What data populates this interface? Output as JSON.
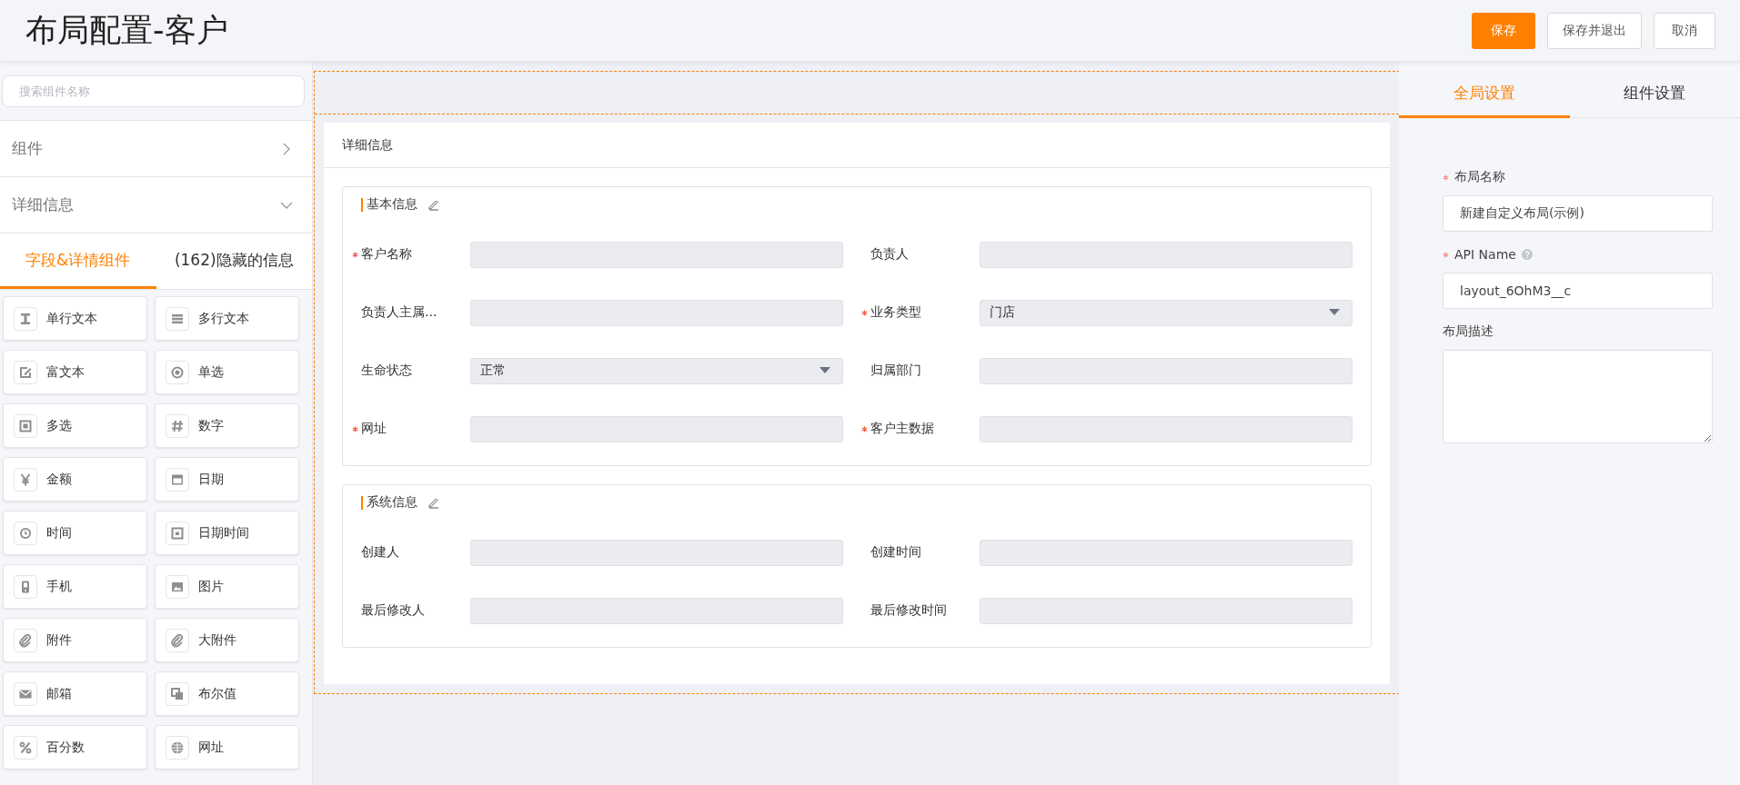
{
  "header": {
    "title": "布局配置-客户",
    "buttons": [
      {
        "label": "保存",
        "kind": "primary"
      },
      {
        "label": "保存并退出",
        "kind": "default"
      },
      {
        "label": "取消",
        "kind": "default"
      }
    ]
  },
  "sidebar": {
    "search": {
      "placeholder": "搜索组件名称"
    },
    "sections": [
      {
        "label": "组件",
        "expanded": false
      },
      {
        "label": "详细信息",
        "expanded": true
      }
    ],
    "tabs": [
      {
        "label": "字段&详情组件",
        "selected": true
      },
      {
        "label": "(162)隐藏的信息",
        "selected": false
      }
    ],
    "components": [
      {
        "label": "单行文本",
        "kind": "text"
      },
      {
        "label": "多行文本",
        "kind": "textarea"
      },
      {
        "label": "富文本",
        "kind": "richtext"
      },
      {
        "label": "单选",
        "kind": "radio"
      },
      {
        "label": "多选",
        "kind": "checkbox"
      },
      {
        "label": "数字",
        "kind": "number"
      },
      {
        "label": "金额",
        "kind": "currency"
      },
      {
        "label": "日期",
        "kind": "date"
      },
      {
        "label": "时间",
        "kind": "time"
      },
      {
        "label": "日期时间",
        "kind": "datetime"
      },
      {
        "label": "手机",
        "kind": "phone"
      },
      {
        "label": "图片",
        "kind": "image"
      },
      {
        "label": "附件",
        "kind": "attachment"
      },
      {
        "label": "大附件",
        "kind": "attachment"
      },
      {
        "label": "邮箱",
        "kind": "email"
      },
      {
        "label": "布尔值",
        "kind": "boolean"
      },
      {
        "label": "百分数",
        "kind": "percent"
      },
      {
        "label": "网址",
        "kind": "url"
      }
    ]
  },
  "canvas": {
    "card_title": "详细信息",
    "groups": [
      {
        "title": "基本信息",
        "fields": [
          {
            "label": "客户名称",
            "required": true,
            "kind": "text"
          },
          {
            "label": "负责人",
            "required": false,
            "kind": "text"
          },
          {
            "label": "负责人主属...",
            "required": false,
            "kind": "text"
          },
          {
            "label": "业务类型",
            "required": true,
            "kind": "select",
            "value": "门店"
          },
          {
            "label": "生命状态",
            "required": false,
            "kind": "select",
            "value": "正常"
          },
          {
            "label": "归属部门",
            "required": false,
            "kind": "text"
          },
          {
            "label": "网址",
            "required": true,
            "kind": "text"
          },
          {
            "label": "客户主数据",
            "required": true,
            "kind": "text"
          }
        ]
      },
      {
        "title": "系统信息",
        "fields": [
          {
            "label": "创建人",
            "required": false,
            "kind": "text"
          },
          {
            "label": "创建时间",
            "required": false,
            "kind": "text"
          },
          {
            "label": "最后修改人",
            "required": false,
            "kind": "text"
          },
          {
            "label": "最后修改时间",
            "required": false,
            "kind": "text"
          }
        ]
      }
    ]
  },
  "settings": {
    "tabs": [
      {
        "label": "全局设置",
        "selected": true
      },
      {
        "label": "组件设置",
        "selected": false
      }
    ],
    "fields": [
      {
        "label": "布局名称",
        "required": true,
        "help": false,
        "kind": "input",
        "value": "新建自定义布局(示例)"
      },
      {
        "label": "API Name",
        "required": true,
        "help": true,
        "kind": "input",
        "value": "layout_6OhM3__c"
      },
      {
        "label": "布局描述",
        "required": false,
        "help": false,
        "kind": "textarea"
      }
    ]
  }
}
